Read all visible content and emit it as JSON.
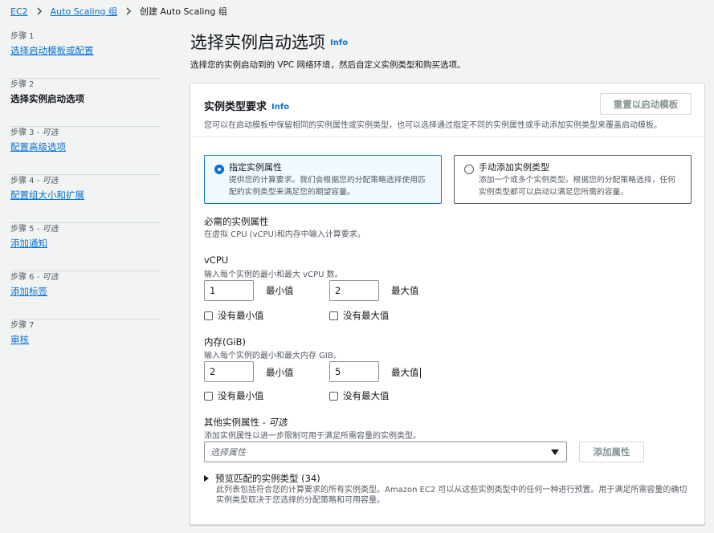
{
  "breadcrumb": {
    "items": [
      "EC2",
      "Auto Scaling 组"
    ],
    "current": "创建 Auto Scaling 组"
  },
  "steps": [
    {
      "num": "步骤 1",
      "optional": "",
      "label": "选择启动模板或配置"
    },
    {
      "num": "步骤 2",
      "optional": "",
      "label": "选择实例启动选项"
    },
    {
      "num": "步骤 3",
      "optional": " - 可选",
      "label": "配置高级选项"
    },
    {
      "num": "步骤 4",
      "optional": " - 可选",
      "label": "配置组大小和扩展"
    },
    {
      "num": "步骤 5",
      "optional": " - 可选",
      "label": "添加通知"
    },
    {
      "num": "步骤 6",
      "optional": " - 可选",
      "label": "添加标签"
    },
    {
      "num": "步骤 7",
      "optional": "",
      "label": "审核"
    }
  ],
  "header": {
    "title": "选择实例启动选项",
    "info": "Info",
    "description": "选择您的实例启动到的 VPC 网络环境，然后自定义实例类型和购买选项。"
  },
  "instance_type": {
    "title": "实例类型要求",
    "info": "Info",
    "reset_button": "重置以启动模板",
    "description": "您可以在启动模板中保留相同的实例属性或实例类型，也可以选择通过指定不同的实例属性或手动添加实例类型来覆盖启动模板。",
    "tiles": [
      {
        "title": "指定实例属性",
        "desc": "提供您的计算要求。我们会根据您的分配策略选择使用匹配的实例类型来满足您的期望容量。",
        "selected": true
      },
      {
        "title": "手动添加实例类型",
        "desc": "添加一个或多个实例类型。根据您的分配策略选择，任何实例类型都可以启动以满足您所需的容量。",
        "selected": false
      }
    ]
  },
  "required": {
    "title": "必需的实例属性",
    "desc": "在虚拟 CPU (vCPU)和内存中输入计算要求。"
  },
  "vcpu": {
    "title": "vCPU",
    "desc": "输入每个实例的最小和最大 vCPU 数。",
    "min_value": "1",
    "min_label": "最小值",
    "max_value": "2",
    "max_label": "最大值",
    "no_min": "没有最小值",
    "no_max": "没有最大值"
  },
  "memory": {
    "title": "内存(GiB)",
    "desc": "输入每个实例的最小和最大内存 GIB。",
    "min_value": "2",
    "min_label": "最小值",
    "max_value": "5",
    "max_label": "最大值",
    "no_min": "没有最小值",
    "no_max": "没有最大值"
  },
  "other": {
    "title": "其他实例属性",
    "optional": " - 可选",
    "desc": "添加实例属性以进一步限制可用于满足所需容量的实例类型。",
    "select_placeholder": "选择属性",
    "add_button": "添加属性"
  },
  "preview": {
    "title": "预览匹配的实例类型 (34)",
    "desc": "此列表包括符合您的计算要求的所有实例类型。Amazon EC2 可以从这些实例类型中的任何一种进行预置。用于满足所需容量的确切实例类型取决于您选择的分配策略和可用容量。"
  }
}
